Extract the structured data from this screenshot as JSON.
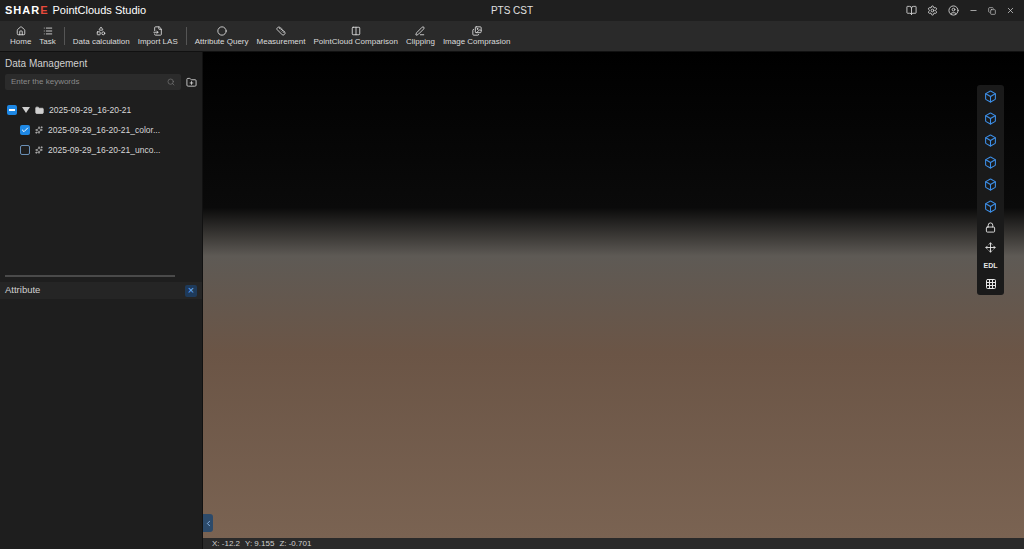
{
  "window": {
    "logo_prefix": "SHAR",
    "logo_accent": "E",
    "app_name": "PointClouds Studio",
    "title": "PTS CST"
  },
  "toolbar": [
    {
      "label": "Home",
      "separator_after": false
    },
    {
      "label": "Task",
      "separator_after": true
    },
    {
      "label": "Data calculation",
      "separator_after": false
    },
    {
      "label": "Import LAS",
      "separator_after": true
    },
    {
      "label": "Attribute Query",
      "separator_after": false
    },
    {
      "label": "Measurement",
      "separator_after": false
    },
    {
      "label": "PointCloud Comparison",
      "separator_after": false
    },
    {
      "label": "Clipping",
      "separator_after": false
    },
    {
      "label": "Image Comprasion",
      "separator_after": false
    }
  ],
  "data_panel": {
    "title": "Data Management",
    "search_placeholder": "Enter the keywords",
    "tree": {
      "label": "2025-09-29_16-20-21",
      "expanded": true,
      "checked": false,
      "indeterminate": true,
      "children": [
        {
          "label": "2025-09-29_16-20-21_color...",
          "checked": true
        },
        {
          "label": "2025-09-29_16-20-21_unco...",
          "checked": false
        }
      ]
    }
  },
  "attribute_panel": {
    "title": "Attribute",
    "close": "×"
  },
  "view_toolbar": {
    "edl_label": "EDL"
  },
  "status_bar": {
    "coordinates": [
      "X: -12.2",
      "Y: 9.155",
      "Z: -0.701"
    ]
  }
}
